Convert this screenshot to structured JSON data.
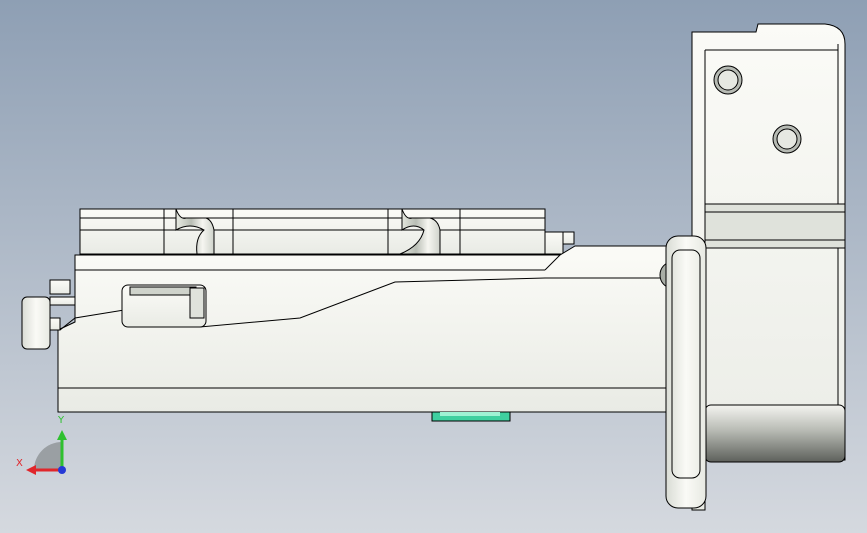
{
  "viewport": {
    "background_top": "#8e9fb4",
    "background_bottom": "#d5d9df"
  },
  "model": {
    "name": "",
    "edge_color": "#000000",
    "face_color": "#f4f4ef",
    "shade_color": "#c7ccc6",
    "dark_face_color": "#6d706b",
    "accent_color": "#3fcf9f"
  },
  "triad": {
    "x_label": "X",
    "y_label": "Y",
    "x_color": "#e0262b",
    "y_color": "#2fc02f",
    "z_color": "#2539d6"
  }
}
